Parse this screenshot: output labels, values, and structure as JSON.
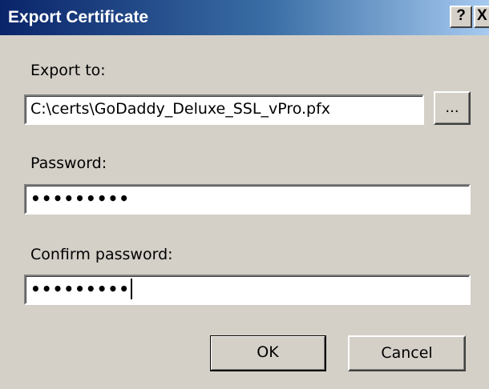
{
  "window": {
    "title": "Export Certificate",
    "help_label": "?",
    "close_label": "X"
  },
  "export_to": {
    "label": "Export to:",
    "value": "C:\\certs\\GoDaddy_Deluxe_SSL_vPro.pfx",
    "browse_label": "..."
  },
  "password": {
    "label": "Password:",
    "value": "•••••••••"
  },
  "confirm_password": {
    "label": "Confirm password:",
    "value": "•••••••••"
  },
  "buttons": {
    "ok_label": "OK",
    "cancel_label": "Cancel"
  }
}
